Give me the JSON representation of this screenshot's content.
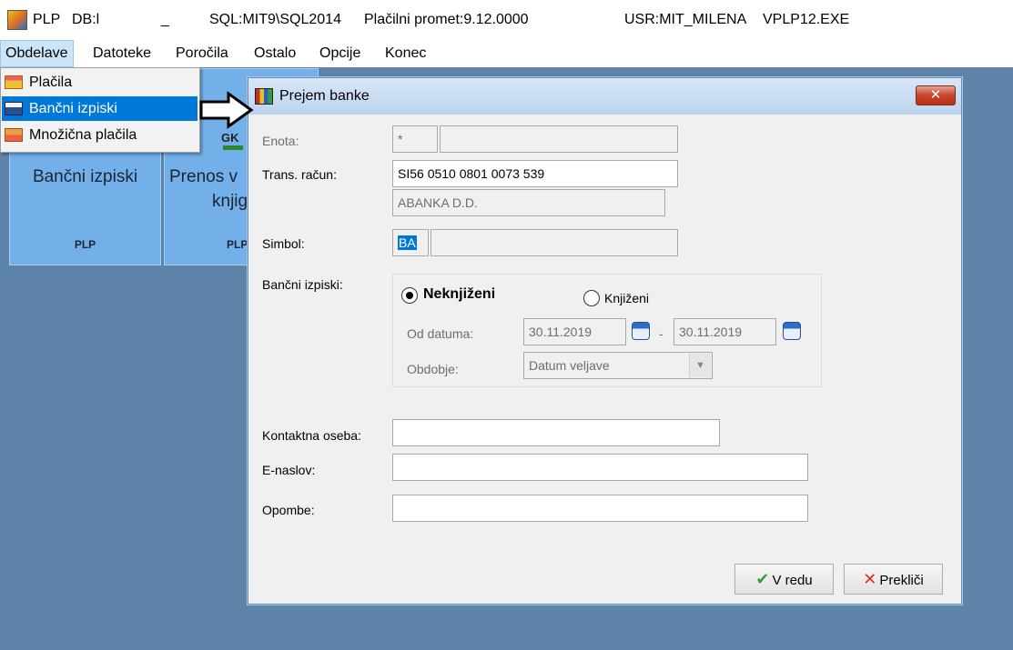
{
  "titlebar": {
    "app": "PLP",
    "db": "DB:l",
    "underscore": "_",
    "sql": "SQL:MIT9\\SQL2014",
    "version": "Plačilni promet:9.12.0000",
    "user": "USR:MIT_MILENA",
    "exe": "VPLP12.EXE"
  },
  "menu": {
    "items": [
      "Obdelave",
      "Datoteke",
      "Poročila",
      "Ostalo",
      "Opcije",
      "Konec"
    ],
    "active": "Obdelave"
  },
  "dropdown": {
    "items": [
      {
        "label": "Plačila",
        "icon": "payments-icon"
      },
      {
        "label": "Bančni izpiski",
        "icon": "folder-open-icon"
      },
      {
        "label": "Množična plačila",
        "icon": "bulk-payments-icon"
      }
    ],
    "selected": "Bančni izpiski"
  },
  "tiles": [
    {
      "title": "Bančni izpiski",
      "footer": "PLP"
    },
    {
      "title": "Prenos v",
      "title2": "knjig",
      "footer": "PLP",
      "peek": "GK"
    }
  ],
  "dialog": {
    "title": "Prejem banke",
    "close": "✕",
    "labels": {
      "enota": "Enota:",
      "trans_racun": "Trans. račun:",
      "simbol": "Simbol:",
      "bancni_izpiski": "Bančni izpiski:",
      "od_datuma": "Od datuma:",
      "obdobje": "Obdobje:",
      "kontaktna_oseba": "Kontaktna oseba:",
      "e_naslov": "E-naslov:",
      "opombe": "Opombe:"
    },
    "fields": {
      "enota_code": "*",
      "enota_name": "",
      "trans_racun": "SI56 0510 0801 0073 539",
      "bank_name": "ABANKA D.D.",
      "simbol_code": "BA",
      "simbol_name": "",
      "date_from": "30.11.2019",
      "date_sep": "-",
      "date_to": "30.11.2019",
      "obdobje": "Datum veljave",
      "kontaktna_oseba": "",
      "e_naslov": "",
      "opombe": ""
    },
    "radios": {
      "neknjizeni": "Neknjiženi",
      "knjizeni": "Knjiženi",
      "checked": "Neknjiženi"
    },
    "buttons": {
      "ok": "V redu",
      "cancel": "Prekliči"
    }
  }
}
